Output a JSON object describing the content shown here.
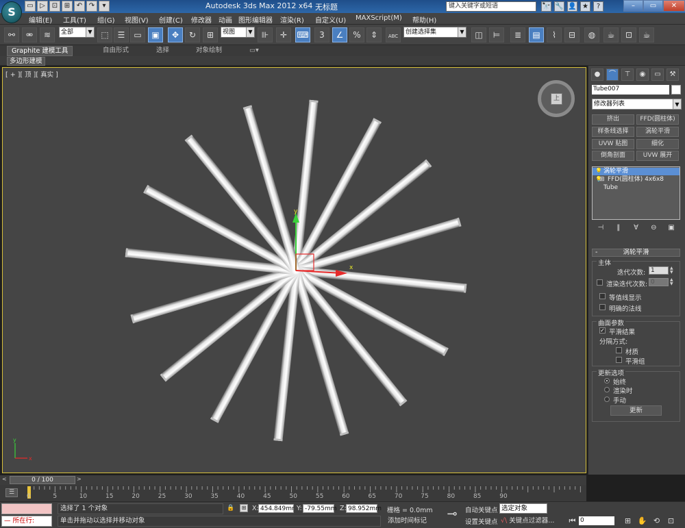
{
  "app": {
    "logo": "S",
    "title": "Autodesk 3ds Max  2012 x64",
    "document": "无标题",
    "search_placeholder": "键入关键字或短语",
    "quick_access": [
      "▭",
      "▷",
      "⊡",
      "⊞",
      "↶",
      "↷",
      "▾"
    ],
    "title_icons": [
      "🔭",
      "🔧",
      "👤",
      "★",
      "?"
    ],
    "window_controls": {
      "minimize": "–",
      "maximize": "▭",
      "close": "✕"
    }
  },
  "menu": [
    "编辑(E)",
    "工具(T)",
    "组(G)",
    "视图(V)",
    "创建(C)",
    "修改器",
    "动画",
    "图形编辑器",
    "渲染(R)",
    "自定义(U)",
    "MAXScript(M)",
    "帮助(H)"
  ],
  "toolbar": {
    "selection_filter": "全部",
    "reference_coord": "视图",
    "named_selection": "创建选择集",
    "snap_label": "3",
    "percent_label": "%",
    "abc_label": "ABC"
  },
  "ribbon": {
    "tabs": [
      "Graphite 建模工具",
      "自由形式",
      "选择",
      "对象绘制"
    ],
    "active_sub": "多边形建模"
  },
  "viewport": {
    "label": "[ + ][ 顶 ][ 真实 ]",
    "viewcube_face": "上",
    "axis_x": "x",
    "axis_y": "y",
    "spokes": 16,
    "border_color": "#d8c13a"
  },
  "command_panel": {
    "tabs": [
      "sphere-icon",
      "bend-icon",
      "hierarchy-icon",
      "motion-icon",
      "display-icon",
      "hammer-icon"
    ],
    "object_name": "Tube007",
    "modifier_list": "修改器列表",
    "modifier_buttons": [
      "挤出",
      "FFD(圆柱体)",
      "样条线选择",
      "涡轮平滑",
      "UVW 贴图",
      "细化",
      "倒角剖面",
      "UVW 展开"
    ],
    "stack": [
      {
        "label": "涡轮平滑",
        "selected": true
      },
      {
        "label": "FFD(圆柱体) 4x6x8",
        "selected": false
      },
      {
        "label": "Tube",
        "selected": false
      }
    ],
    "stack_tools": [
      "⊣",
      "‖",
      "∀",
      "⊖",
      "▣"
    ],
    "rollout_title": "涡轮平滑",
    "rollout_toggle": "-",
    "main": {
      "title": "主体",
      "iterations_label": "迭代次数:",
      "iterations": "1",
      "render_iter_label": "渲染迭代次数:",
      "render_iter": "0",
      "isoline_label": "等值线显示",
      "explicit_normals_label": "明确的法线"
    },
    "surface": {
      "title": "曲面参数",
      "smooth_result_label": "平滑结果",
      "separate_by_label": "分隔方式:",
      "materials_label": "材质",
      "smoothing_groups_label": "平滑组"
    },
    "update": {
      "title": "更新选项",
      "always_label": "始终",
      "when_render_label": "渲染时",
      "manual_label": "手动",
      "update_button": "更新"
    }
  },
  "timeline": {
    "position": "0 / 100",
    "prev": "<",
    "next": ">",
    "track_icon": "☰",
    "ticks": [
      "0",
      "5",
      "10",
      "15",
      "20",
      "25",
      "30",
      "35",
      "40",
      "45",
      "50",
      "55",
      "60",
      "65",
      "70",
      "75",
      "80",
      "85",
      "90"
    ]
  },
  "status": {
    "listener": "所在行:",
    "listener_prefix": "—",
    "selected": "选择了 1 个对象",
    "prompt": "单击并拖动以选择并移动对象",
    "x_label": "X:",
    "x": "454.849mr",
    "y_label": "Y:",
    "y": "-79.55mm",
    "z_label": "Z:",
    "z": "98.952mm",
    "grid": "栅格 = 0.0mm",
    "add_time_tag": "添加时间标记",
    "auto_key": "自动关键点",
    "selected_object": "选定对象",
    "set_key": "设置关键点",
    "key_filters": "关键点过滤器...",
    "frame": "0",
    "key_glyph": "⊸",
    "filter_glyph": "√\\",
    "nav_icons": [
      "⏮",
      "⊞",
      "✋",
      "⟲",
      "⊡"
    ]
  }
}
